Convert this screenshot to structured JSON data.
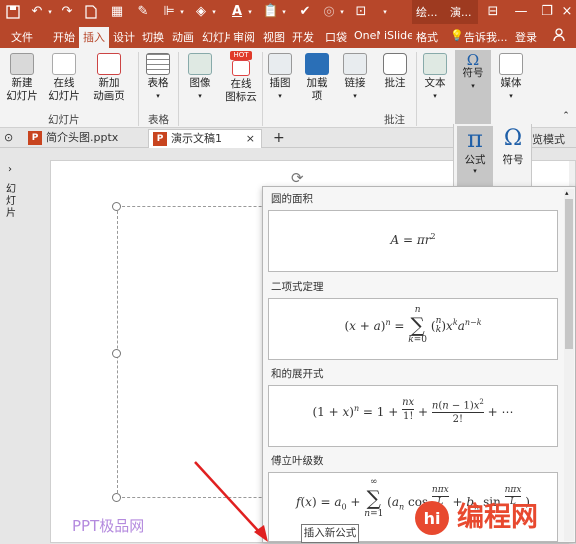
{
  "qat": {
    "window_title_left": "绘...",
    "window_title_right": "演..."
  },
  "tabs": [
    "文件",
    "开始",
    "插入",
    "设计",
    "切换",
    "动画",
    "幻灯片",
    "审阅",
    "视图",
    "开发",
    "口袋",
    "OneN",
    "iSlide",
    "格式"
  ],
  "tabs_extra": {
    "tell_me": "告诉我...",
    "login": "登录"
  },
  "ribbon": {
    "buttons": {
      "new_slide": "新建\n幻灯片",
      "online_slide": "在线\n幻灯片",
      "new_anim_page": "新加\n动画页",
      "table": "表格",
      "image": "图像",
      "online_icons": "在线\n图标云",
      "illustrations": "插图",
      "addins": "加载\n项",
      "link": "链接",
      "comment": "批注",
      "text": "文本",
      "symbols": "符号",
      "media": "媒体"
    },
    "hot_badge": "HOT",
    "groups": {
      "slides": "幻灯片",
      "tables": "表格",
      "comments": "批注"
    }
  },
  "doc_tabs": {
    "tab1": "简介头图.pptx",
    "tab2": "演示文稿1",
    "add": "+"
  },
  "side_labels": {
    "left_pane": "幻灯片",
    "right_fragment": "览模式"
  },
  "symbol_dropdown": {
    "equation": "公式",
    "symbol": "符号"
  },
  "equations": [
    {
      "name": "圆的面积"
    },
    {
      "name": "二项式定理"
    },
    {
      "name": "和的展开式"
    },
    {
      "name": "傅立叶级数"
    }
  ],
  "tooltip": "插入新公式",
  "watermark": {
    "text": "PPT极品网",
    "logo_text": "编程网"
  },
  "colors": {
    "accent": "#b7472a",
    "ribbon_bg": "#f3f3f3"
  }
}
